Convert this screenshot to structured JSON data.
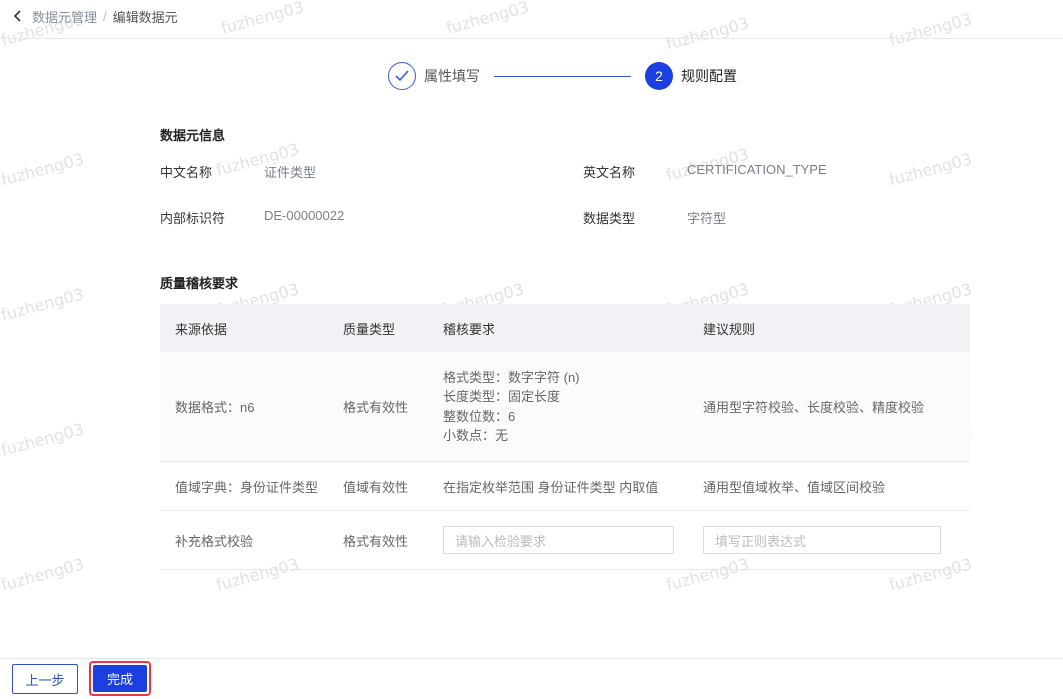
{
  "watermark": "fuzheng03",
  "breadcrumb": {
    "parent": "数据元管理",
    "separator": "/",
    "current": "编辑数据元"
  },
  "steps": [
    {
      "label": "属性填写",
      "status": "done"
    },
    {
      "number": "2",
      "label": "规则配置",
      "status": "active"
    }
  ],
  "info_section": {
    "title": "数据元信息",
    "fields": {
      "cn_name_label": "中文名称",
      "cn_name_value": "证件类型",
      "en_name_label": "英文名称",
      "en_name_value": "CERTIFICATION_TYPE",
      "internal_id_label": "内部标识符",
      "internal_id_value": "DE-00000022",
      "data_type_label": "数据类型",
      "data_type_value": "字符型"
    }
  },
  "quality_section": {
    "title": "质量稽核要求",
    "columns": [
      "来源依据",
      "质量类型",
      "稽核要求",
      "建议规则"
    ],
    "rows": [
      {
        "source": "数据格式：n6",
        "type": "格式有效性",
        "requirements": [
          "格式类型：数字字符 (n)",
          "长度类型：固定长度",
          "整数位数：6",
          "小数点：无"
        ],
        "rule": "通用型字符校验、长度校验、精度校验"
      },
      {
        "source": "值域字典：身份证件类型",
        "type": "值域有效性",
        "requirement": "在指定枚举范围 身份证件类型 内取值",
        "rule": "通用型值域枚举、值域区间校验"
      },
      {
        "source": "补充格式校验",
        "type": "格式有效性",
        "requirement_placeholder": "请输入检验要求",
        "rule_placeholder": "填写正则表达式"
      }
    ]
  },
  "footer": {
    "prev_label": "上一步",
    "done_label": "完成"
  },
  "colors": {
    "primary": "#1b3fe0",
    "highlight_border": "#e8374a"
  }
}
